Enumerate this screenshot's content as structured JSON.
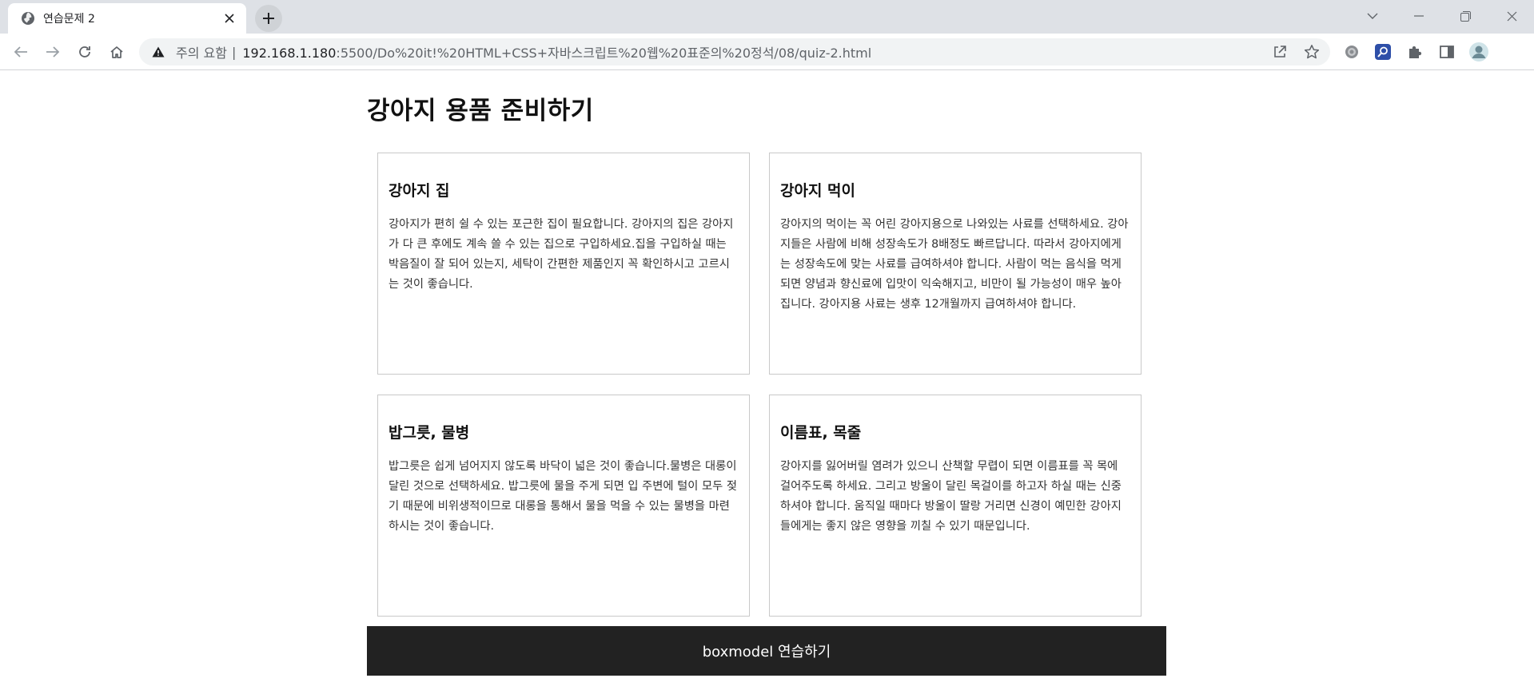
{
  "browser": {
    "tab": {
      "title": "연습문제 2"
    },
    "omnibox": {
      "security_label": "주의 요함",
      "separator": "|",
      "url_host": "192.168.1.180",
      "url_path": ":5500/Do%20it!%20HTML+CSS+자바스크립트%20웹%20표준의%20정석/08/quiz-2.html"
    }
  },
  "page": {
    "title": "강아지 용품 준비하기",
    "cards": [
      {
        "title": "강아지 집",
        "text": "강아지가 편히 쉴 수 있는 포근한 집이 필요합니다. 강아지의 집은 강아지가 다 큰 후에도 계속 쓸 수 있는 집으로 구입하세요.집을 구입하실 때는 박음질이 잘 되어 있는지, 세탁이 간편한 제품인지 꼭 확인하시고 고르시는 것이 좋습니다."
      },
      {
        "title": "강아지 먹이",
        "text": "강아지의 먹이는 꼭 어린 강아지용으로 나와있는 사료를 선택하세요. 강아지들은 사람에 비해 성장속도가 8배정도 빠르답니다. 따라서 강아지에게는 성장속도에 맞는 사료를 급여하셔야 합니다. 사람이 먹는 음식을 먹게 되면 양념과 향신료에 입맛이 익숙해지고, 비만이 될 가능성이 매우 높아집니다. 강아지용 사료는 생후 12개월까지 급여하셔야 합니다."
      },
      {
        "title": "밥그릇, 물병",
        "text": "밥그릇은 쉽게 넘어지지 않도록 바닥이 넓은 것이 좋습니다.물병은 대롱이 달린 것으로 선택하세요. 밥그릇에 물을 주게 되면 입 주변에 털이 모두 젖기 때문에 비위생적이므로 대롱을 통해서 물을 먹을 수 있는 물병을 마련하시는 것이 좋습니다."
      },
      {
        "title": "이름표, 목줄",
        "text": "강아지를 잃어버릴 염려가 있으니 산책할 무렵이 되면 이름표를 꼭 목에 걸어주도록 하세요. 그리고 방울이 달린 목걸이를 하고자 하실 때는 신중하셔야 합니다. 움직일 때마다 방울이 딸랑 거리면 신경이 예민한 강아지들에게는 좋지 않은 영향을 끼칠 수 있기 때문입니다."
      }
    ],
    "footer": "boxmodel 연습하기"
  },
  "colors": {
    "tabstrip": "#dee1e6",
    "footer_bg": "#222222",
    "card_border": "#c9c9c9"
  },
  "icons": {
    "favicon": "globe-icon",
    "extensions": [
      "settings-gear-icon",
      "search-extension-icon",
      "puzzle-icon",
      "side-panel-icon",
      "profile-avatar-icon"
    ]
  }
}
